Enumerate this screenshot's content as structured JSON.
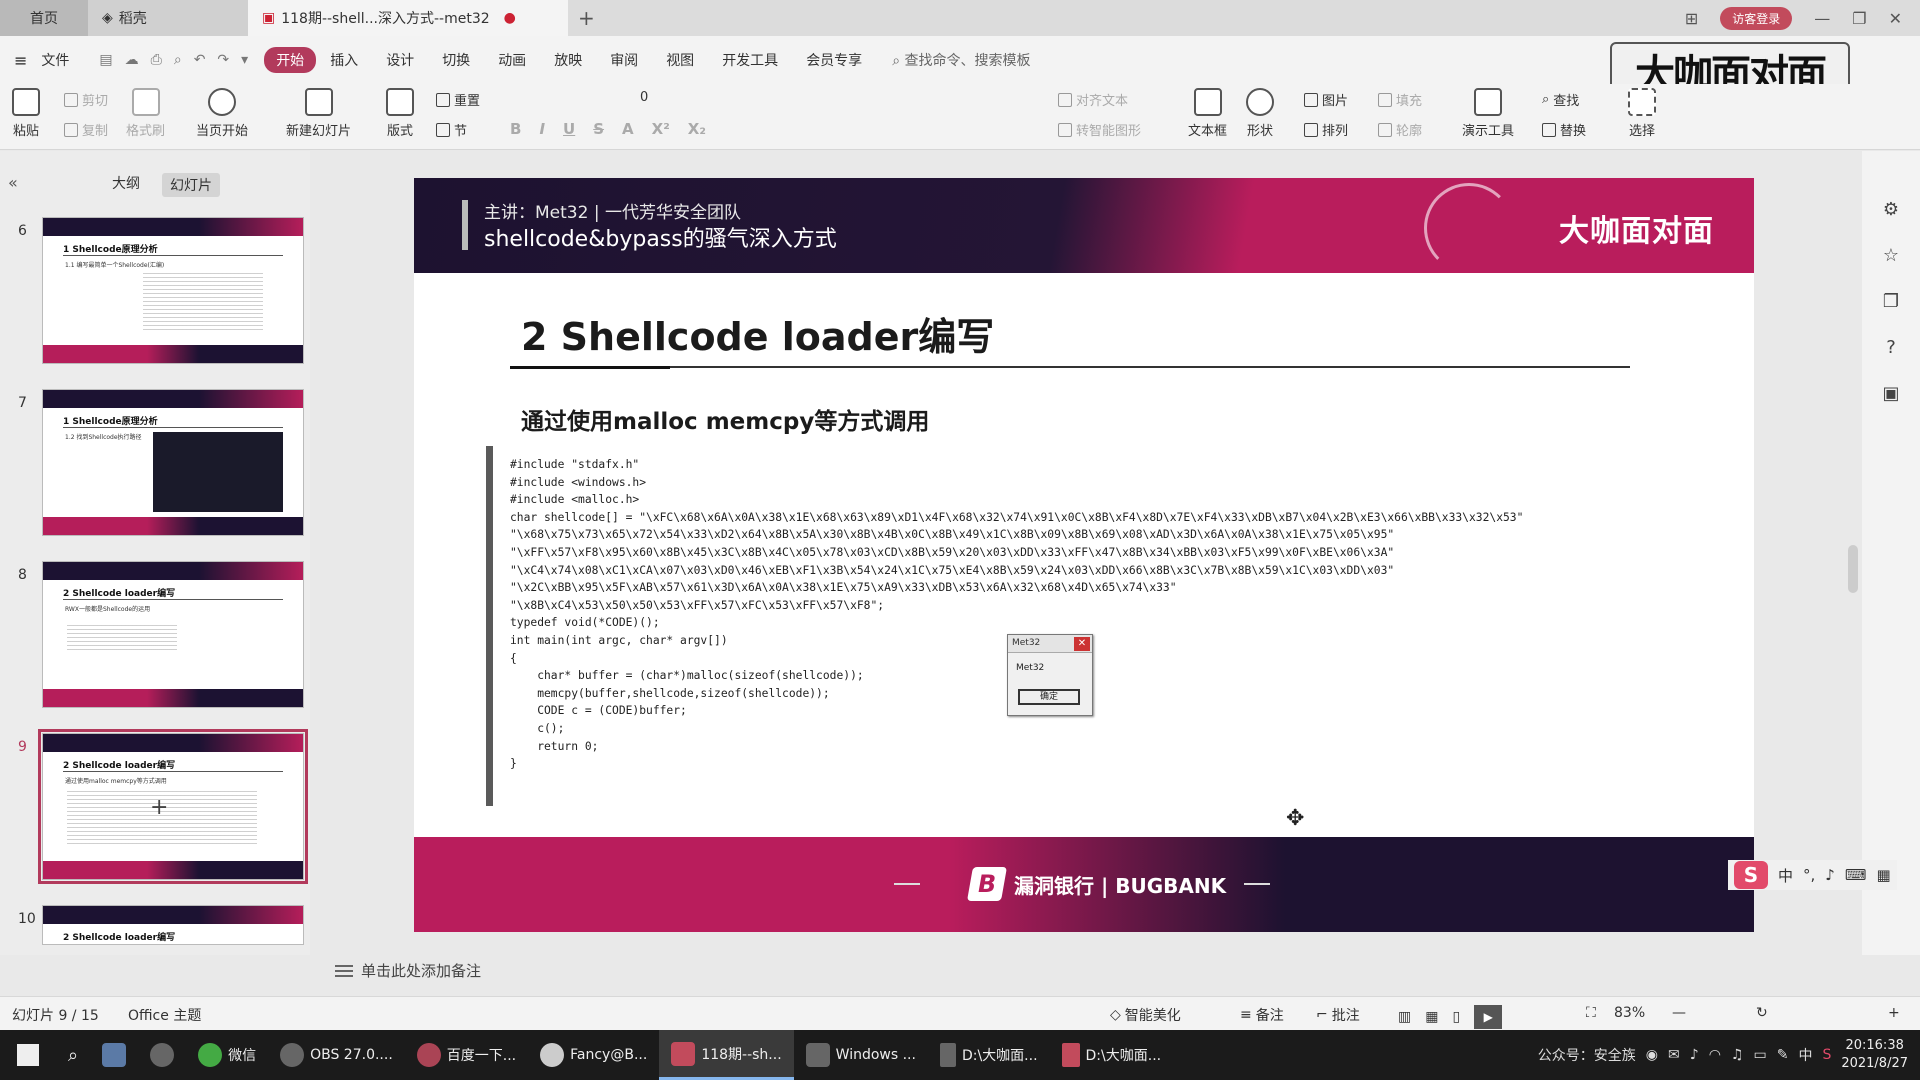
{
  "tabs": {
    "home": "首页",
    "daoke": "稻壳",
    "document": "118期--shell...深入方式--met32",
    "add": "+"
  },
  "title_bar": {
    "visitor_login": "访客登录"
  },
  "menu": {
    "file": "文件",
    "items": [
      "开始",
      "插入",
      "设计",
      "切换",
      "动画",
      "放映",
      "审阅",
      "视图",
      "开发工具",
      "会员专享"
    ],
    "active": "开始",
    "search_placeholder": "查找命令、搜索模板"
  },
  "brand_overlay": "大咖面对面",
  "ribbon": {
    "paste": "粘贴",
    "cut": "剪切",
    "copy": "复制",
    "format_painter": "格式刷",
    "from_current": "当页开始",
    "new_slide": "新建幻灯片",
    "layout": "版式",
    "reset": "重置",
    "section": "节",
    "font_size": "0",
    "align_text": "对齐文本",
    "smart_art": "转智能图形",
    "textbox": "文本框",
    "shape": "形状",
    "picture": "图片",
    "arrange": "排列",
    "fill": "填充",
    "outline": "轮廓",
    "presentation_tools": "演示工具",
    "find": "查找",
    "replace": "替换",
    "select": "选择"
  },
  "left_panel": {
    "tab_outline": "大纲",
    "tab_slides": "幻灯片",
    "thumbnails": [
      {
        "num": "6",
        "title": "1 Shellcode原理分析",
        "sub": "1.1 编写最简单一个Shellcode(汇编)"
      },
      {
        "num": "7",
        "title": "1 Shellcode原理分析",
        "sub": "1.2 找到Shellcode执行路径"
      },
      {
        "num": "8",
        "title": "2 Shellcode loader编写",
        "sub": "RWX一般都是Shellcode的运用"
      },
      {
        "num": "9",
        "title": "2 Shellcode loader编写",
        "sub": "通过使用malloc memcpy等方式调用"
      },
      {
        "num": "10",
        "title": "2 Shellcode loader编写",
        "sub": ""
      }
    ],
    "selected": "9"
  },
  "slide": {
    "presenter": "主讲：Met32 | 一代芳华安全团队",
    "topic": "shellcode&bypass的骚气深入方式",
    "header_logo": "大咖面对面",
    "title": "2 Shellcode loader编写",
    "subtitle": "通过使用malloc memcpy等方式调用",
    "code": "#include \"stdafx.h\"\n#include <windows.h>\n#include <malloc.h>\nchar shellcode[] = \"\\xFC\\x68\\x6A\\x0A\\x38\\x1E\\x68\\x63\\x89\\xD1\\x4F\\x68\\x32\\x74\\x91\\x0C\\x8B\\xF4\\x8D\\x7E\\xF4\\x33\\xDB\\xB7\\x04\\x2B\\xE3\\x66\\xBB\\x33\\x32\\x53\"\n\"\\x68\\x75\\x73\\x65\\x72\\x54\\x33\\xD2\\x64\\x8B\\x5A\\x30\\x8B\\x4B\\x0C\\x8B\\x49\\x1C\\x8B\\x09\\x8B\\x69\\x08\\xAD\\x3D\\x6A\\x0A\\x38\\x1E\\x75\\x05\\x95\"\n\"\\xFF\\x57\\xF8\\x95\\x60\\x8B\\x45\\x3C\\x8B\\x4C\\x05\\x78\\x03\\xCD\\x8B\\x59\\x20\\x03\\xDD\\x33\\xFF\\x47\\x8B\\x34\\xBB\\x03\\xF5\\x99\\x0F\\xBE\\x06\\x3A\"\n\"\\xC4\\x74\\x08\\xC1\\xCA\\x07\\x03\\xD0\\x46\\xEB\\xF1\\x3B\\x54\\x24\\x1C\\x75\\xE4\\x8B\\x59\\x24\\x03\\xDD\\x66\\x8B\\x3C\\x7B\\x8B\\x59\\x1C\\x03\\xDD\\x03\"\n\"\\x2C\\xBB\\x95\\x5F\\xAB\\x57\\x61\\x3D\\x6A\\x0A\\x38\\x1E\\x75\\xA9\\x33\\xDB\\x53\\x6A\\x32\\x68\\x4D\\x65\\x74\\x33\"\n\"\\x8B\\xC4\\x53\\x50\\x50\\x53\\xFF\\x57\\xFC\\x53\\xFF\\x57\\xF8\";\ntypedef void(*CODE)();\nint main(int argc, char* argv[])\n{\n    char* buffer = (char*)malloc(sizeof(shellcode));\n    memcpy(buffer,shellcode,sizeof(shellcode));\n    CODE c = (CODE)buffer;\n    c();\n    return 0;\n}",
    "msgbox_title": "Met32",
    "msgbox_body": "Met32",
    "msgbox_ok": "确定",
    "footer_brand": "漏洞银行 | BUGBANK",
    "footer_b": "B"
  },
  "notes_placeholder": "单击此处添加备注",
  "statusbar": {
    "slide_info": "幻灯片 9 / 15",
    "theme": "Office 主题",
    "beautify": "智能美化",
    "notes": "备注",
    "comments": "批注",
    "zoom": "83%"
  },
  "ime": {
    "logo": "S",
    "mode": "中"
  },
  "taskbar": {
    "apps": [
      {
        "label": "微信",
        "active": false
      },
      {
        "label": "OBS 27.0....",
        "active": false
      },
      {
        "label": "百度一下...",
        "active": false
      },
      {
        "label": "Fancy@B...",
        "active": false
      },
      {
        "label": "118期--sh...",
        "active": true
      },
      {
        "label": "Windows ...",
        "active": false
      },
      {
        "label": "D:\\大咖面...",
        "active": false
      },
      {
        "label": "D:\\大咖面...",
        "active": false
      }
    ],
    "tray_text": "公众号：安全族",
    "tray_lang": "中",
    "time": "20:16:38",
    "date": "2021/8/27"
  },
  "colors": {
    "accent": "#b23a5c",
    "slide_dark": "#1d1230",
    "slide_magenta": "#b91d5c"
  }
}
